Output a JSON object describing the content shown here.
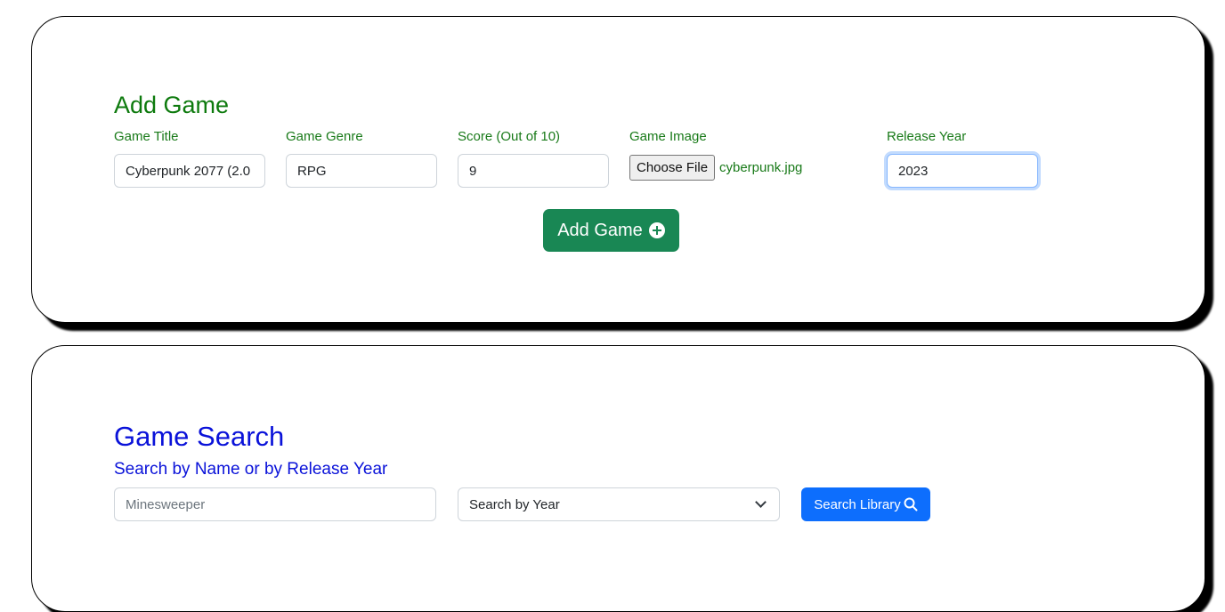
{
  "add_game": {
    "title": "Add Game",
    "labels": {
      "game_title": "Game Title",
      "game_genre": "Game Genre",
      "score": "Score (Out of 10)",
      "game_image": "Game Image",
      "release_year": "Release Year"
    },
    "values": {
      "game_title": "Cyberpunk 2077 (2.0",
      "game_genre": "RPG",
      "score": "9",
      "release_year": "2023"
    },
    "file_button_label": "Choose File",
    "file_name": "cyberpunk.jpg",
    "submit_label": "Add Game",
    "submit_icon": "plus-circle-icon",
    "colors": {
      "heading": "#0d7a0d",
      "button": "#198754"
    }
  },
  "game_search": {
    "title": "Game Search",
    "subtitle": "Search by Name or by Release Year",
    "name_placeholder": "Minesweeper",
    "select_value": "Search by Year",
    "submit_label": "Search Library",
    "submit_icon": "search-icon",
    "colors": {
      "heading": "#0a12d9",
      "button": "#0d6efd"
    }
  }
}
